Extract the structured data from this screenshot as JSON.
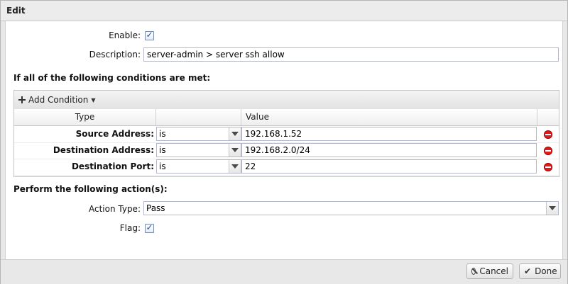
{
  "window": {
    "title": "Edit"
  },
  "form": {
    "enable_label": "Enable:",
    "enable_checked": true,
    "description_label": "Description:",
    "description_value": "server-admin > server ssh allow"
  },
  "conditions": {
    "heading": "If all of the following conditions are met:",
    "add_label": "Add Condition",
    "columns": {
      "type": "Type",
      "op": "",
      "value": "Value"
    },
    "rows": [
      {
        "label": "Source Address:",
        "op": "is",
        "value": "192.168.1.52"
      },
      {
        "label": "Destination Address:",
        "op": "is",
        "value": "192.168.2.0/24"
      },
      {
        "label": "Destination Port:",
        "op": "is",
        "value": "22"
      }
    ]
  },
  "actions": {
    "heading": "Perform the following action(s):",
    "action_type_label": "Action Type:",
    "action_type_value": "Pass",
    "flag_label": "Flag:",
    "flag_checked": true
  },
  "footer": {
    "cancel_label": "Cancel",
    "done_label": "Done"
  },
  "icons": [
    "plus-icon",
    "caret-down-icon",
    "remove-icon",
    "chevron-down-icon",
    "cancel-icon",
    "check-icon"
  ]
}
